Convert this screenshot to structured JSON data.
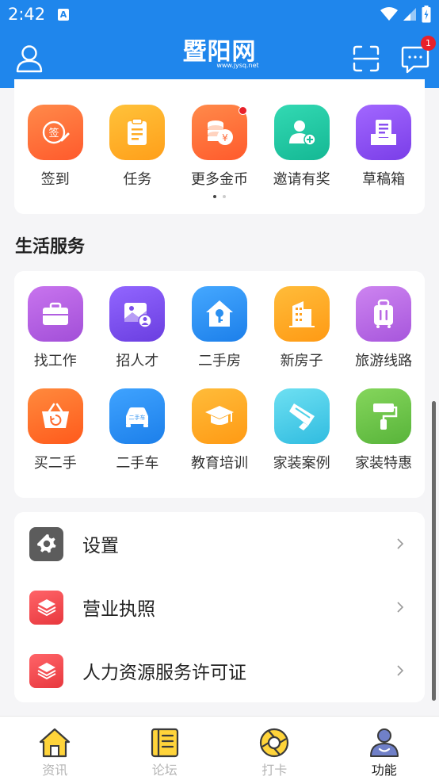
{
  "status": {
    "time": "2:42"
  },
  "header": {
    "logo_text": "暨阳网",
    "logo_sub": "www.jysq.net",
    "message_badge": "1"
  },
  "quick_actions": [
    {
      "label": "签到",
      "icon": "sign-in-icon",
      "color": "#ff6b3a"
    },
    {
      "label": "任务",
      "icon": "clipboard-icon",
      "color": "#ffaa1f"
    },
    {
      "label": "更多金币",
      "icon": "coins-icon",
      "color": "#ff6b3a",
      "dot": true
    },
    {
      "label": "邀请有奖",
      "icon": "invite-user-icon",
      "color": "#21c8a6"
    },
    {
      "label": "草稿箱",
      "icon": "drafts-icon",
      "color": "#8a4ff0"
    }
  ],
  "life_section": {
    "title": "生活服务",
    "items": [
      {
        "label": "找工作",
        "icon": "briefcase-icon",
        "color": "#b05ee0"
      },
      {
        "label": "招人才",
        "icon": "recruit-icon",
        "color": "#7b4fe8"
      },
      {
        "label": "二手房",
        "icon": "house-key-icon",
        "color": "#2a8ff0"
      },
      {
        "label": "新房子",
        "icon": "building-icon",
        "color": "#ffa11f"
      },
      {
        "label": "旅游线路",
        "icon": "luggage-icon",
        "color": "#b868e3"
      },
      {
        "label": "买二手",
        "icon": "basket-icon",
        "color": "#ff6b2d"
      },
      {
        "label": "二手车",
        "icon": "car-icon",
        "color": "#2a8ff0",
        "text": "二手车"
      },
      {
        "label": "教育培训",
        "icon": "graduation-cap-icon",
        "color": "#ffa11f"
      },
      {
        "label": "家装案例",
        "icon": "brush-icon",
        "color": "#4fd1e8"
      },
      {
        "label": "家装特惠",
        "icon": "paint-roller-icon",
        "color": "#6cc24a"
      }
    ]
  },
  "settings_list": [
    {
      "label": "设置",
      "icon": "gear-icon",
      "color": "#555555"
    },
    {
      "label": "营业执照",
      "icon": "layers-icon",
      "color": "#f0474d"
    },
    {
      "label": "人力资源服务许可证",
      "icon": "layers-icon",
      "color": "#f0474d"
    }
  ],
  "bottom_nav": [
    {
      "label": "资讯",
      "icon": "home-icon",
      "active": false
    },
    {
      "label": "论坛",
      "icon": "forum-icon",
      "active": false
    },
    {
      "label": "打卡",
      "icon": "checkin-icon",
      "active": false
    },
    {
      "label": "功能",
      "icon": "profile-icon",
      "active": true
    }
  ]
}
